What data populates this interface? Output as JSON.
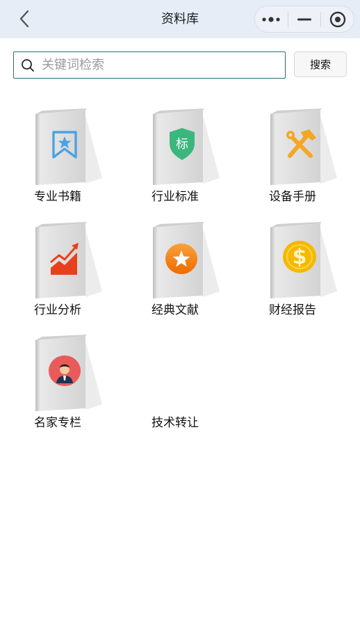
{
  "header": {
    "title": "资料库",
    "back_icon": "chevron-left-icon",
    "capsule": [
      "more-dots-icon",
      "minimize-icon",
      "close-circle-icon"
    ]
  },
  "search": {
    "placeholder": "关键词检索",
    "value": "",
    "button_label": "搜索",
    "icon": "search-icon"
  },
  "colors": {
    "nav_bg": "#e6edf6",
    "search_border": "#2a6d74",
    "bookmark_blue": "#4aa3df",
    "shield_green": "#3bb77e",
    "tools_orange": "#f5a623",
    "chart_red": "#e8401c",
    "star_orange": "#f07a10",
    "coin_yellow": "#f6b800",
    "avatar_red": "#e95b5b"
  },
  "categories": [
    {
      "label": "专业书籍",
      "icon": "bookmark-star-icon"
    },
    {
      "label": "行业标准",
      "icon": "shield-standard-icon",
      "badge": "标"
    },
    {
      "label": "设备手册",
      "icon": "tools-icon"
    },
    {
      "label": "行业分析",
      "icon": "trend-chart-icon"
    },
    {
      "label": "经典文献",
      "icon": "star-circle-icon"
    },
    {
      "label": "财经报告",
      "icon": "dollar-coin-icon"
    },
    {
      "label": "名家专栏",
      "icon": "expert-avatar-icon"
    },
    {
      "label": "技术转让",
      "icon": ""
    }
  ]
}
